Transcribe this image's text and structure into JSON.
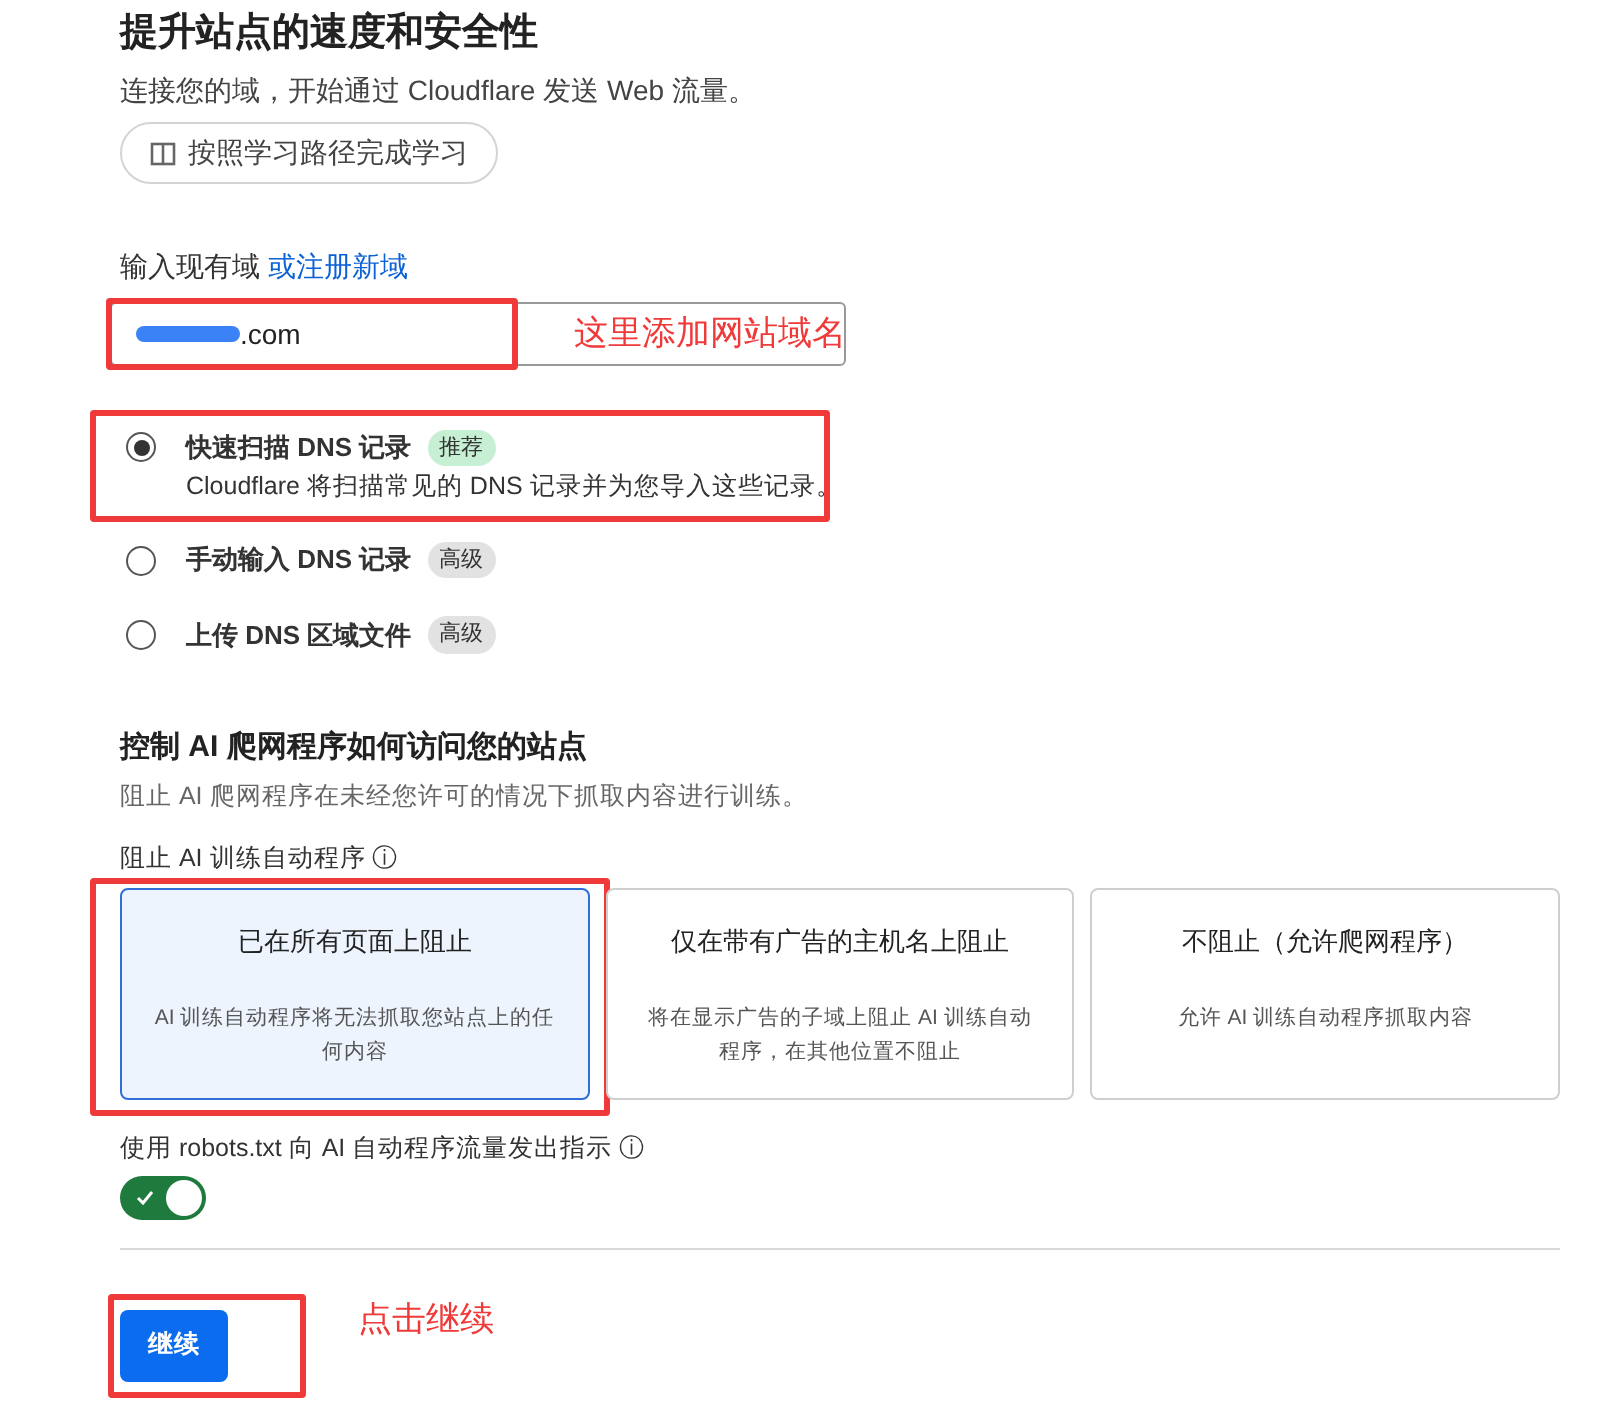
{
  "header": {
    "title": "提升站点的速度和安全性",
    "subtitle": "连接您的域，开始通过 Cloudflare 发送 Web 流量。",
    "learn_button": "按照学习路径完成学习"
  },
  "domain": {
    "label": "输入现有域",
    "link": "或注册新域",
    "value": ".com",
    "redacted": true,
    "highlight": true,
    "annotation": "这里添加网站域名"
  },
  "dns_options": [
    {
      "label": "快速扫描 DNS 记录",
      "badge": {
        "text": "推荐",
        "color": "#c6efd3"
      },
      "description": "Cloudflare 将扫描常见的 DNS 记录并为您导入这些记录。",
      "selected": true,
      "highlight": true
    },
    {
      "label": "手动输入 DNS 记录",
      "badge": {
        "text": "高级",
        "color": "#e2e2e2"
      },
      "selected": false,
      "highlight": false
    },
    {
      "label": "上传 DNS 区域文件",
      "badge": {
        "text": "高级",
        "color": "#e2e2e2"
      },
      "selected": false,
      "highlight": false
    }
  ],
  "ai_section": {
    "title": "控制 AI 爬网程序如何访问您的站点",
    "description": "阻止 AI 爬网程序在未经您许可的情况下抓取内容进行训练。",
    "block_label": "阻止 AI 训练自动程序 ⓘ",
    "cards": [
      {
        "title": "已在所有页面上阻止",
        "description": "AI 训练自动程序将无法抓取您站点上的任何内容",
        "selected": true,
        "highlight": true
      },
      {
        "title": "仅在带有广告的主机名上阻止",
        "description": "将在显示广告的子域上阻止 AI 训练自动程序，在其他位置不阻止",
        "selected": false,
        "highlight": false
      },
      {
        "title": "不阻止（允许爬网程序）",
        "description": "允许 AI 训练自动程序抓取内容",
        "selected": false,
        "highlight": false
      }
    ],
    "robots_label": "使用 robots.txt 向 AI 自动程序流量发出指示 ⓘ",
    "robots_on": true
  },
  "continue": {
    "label": "继续",
    "highlight": true,
    "annotation": "点击继续"
  }
}
